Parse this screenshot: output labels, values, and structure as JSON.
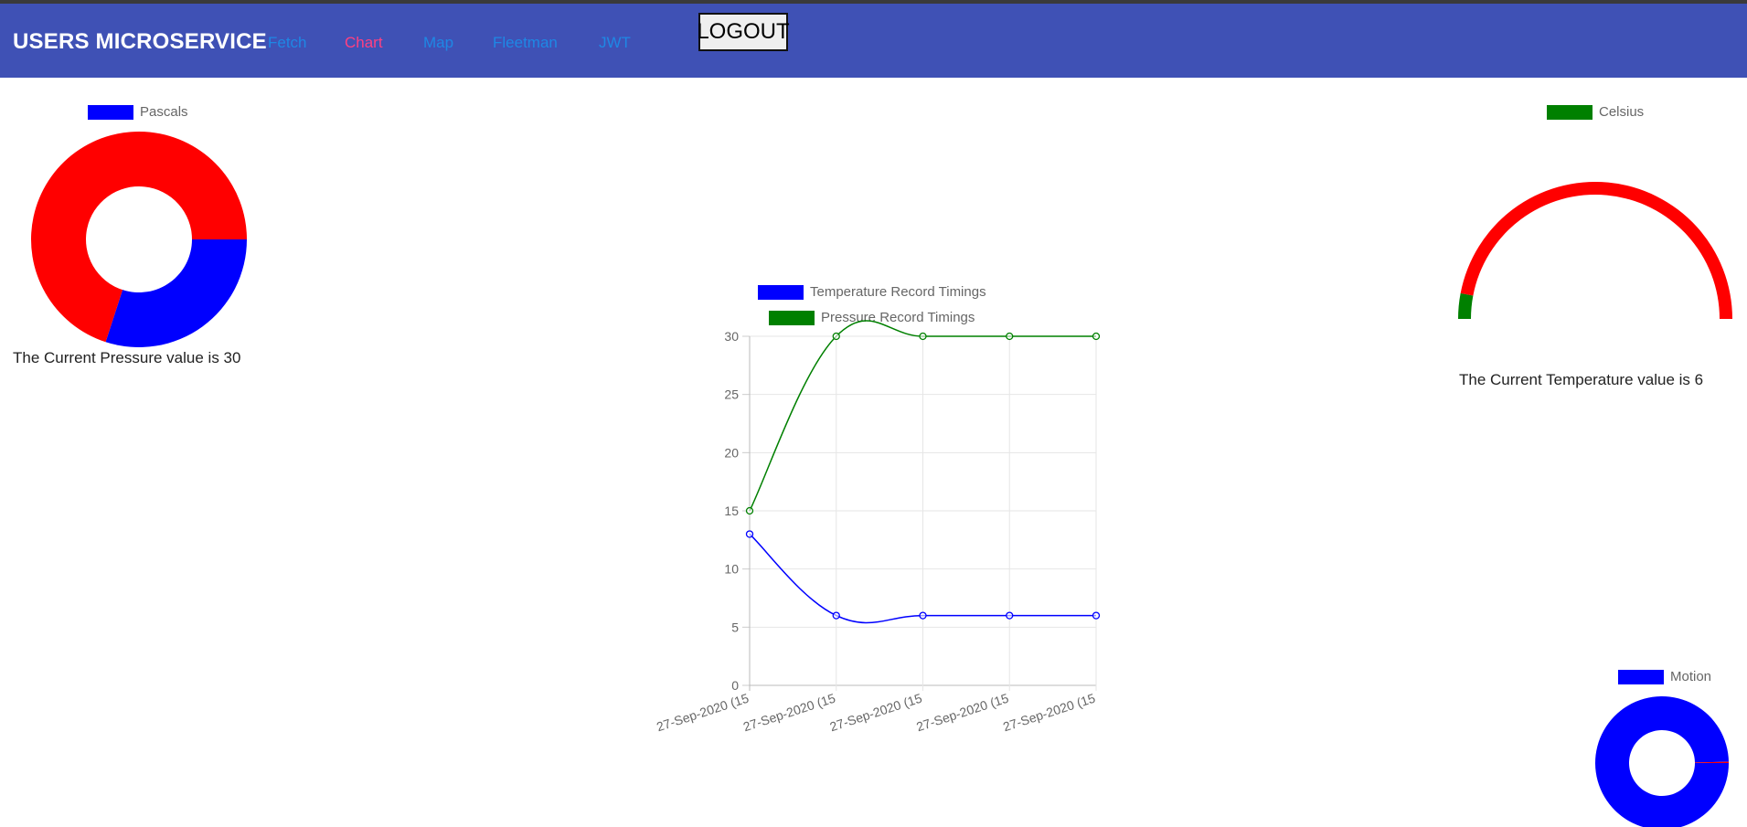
{
  "navbar": {
    "brand": "USERS MICROSERVICE",
    "links": [
      {
        "label": "Fetch",
        "active": false
      },
      {
        "label": "Chart",
        "active": true
      },
      {
        "label": "Map",
        "active": false
      },
      {
        "label": "Fleetman",
        "active": false
      },
      {
        "label": "JWT",
        "active": false
      }
    ],
    "logout_label": "LOGOUT",
    "background": "#3f51b5",
    "link_color": "#1e88e5",
    "active_color": "#ff4081"
  },
  "pressure": {
    "legend": "Pascals",
    "caption": "The Current Pressure value is 30"
  },
  "temperature": {
    "legend": "Celsius",
    "caption": "The Current Temperature value is 6"
  },
  "motion": {
    "legend": "Motion"
  },
  "chart_data": [
    {
      "type": "pie",
      "variant": "doughnut",
      "series_name": "Pascals",
      "slices": [
        {
          "value": 30,
          "color": "#0000ff"
        },
        {
          "value": 70,
          "color": "#ff0000"
        }
      ]
    },
    {
      "type": "pie",
      "variant": "half-doughnut gauge",
      "series_name": "Celsius",
      "slices": [
        {
          "value": 6,
          "color": "#008000"
        },
        {
          "value": 94,
          "color": "#ff0000"
        }
      ]
    },
    {
      "type": "pie",
      "variant": "doughnut",
      "series_name": "Motion",
      "slices": [
        {
          "value": 99.7,
          "color": "#0000ff"
        },
        {
          "value": 0.3,
          "color": "#ff0000"
        }
      ]
    },
    {
      "type": "line",
      "categories": [
        "27-Sep-2020 (15",
        "27-Sep-2020 (15",
        "27-Sep-2020 (15",
        "27-Sep-2020 (15",
        "27-Sep-2020 (15"
      ],
      "series": [
        {
          "name": "Temperature Record Timings",
          "color": "#0000ff",
          "values": [
            13,
            6,
            6,
            6,
            6
          ]
        },
        {
          "name": "Pressure Record Timings",
          "color": "#008000",
          "values": [
            15,
            30,
            30,
            30,
            30
          ]
        }
      ],
      "ylim": [
        0,
        30
      ],
      "yticks": [
        0,
        5,
        10,
        15,
        20,
        25,
        30
      ],
      "grid": true,
      "legend_position": "top"
    }
  ]
}
